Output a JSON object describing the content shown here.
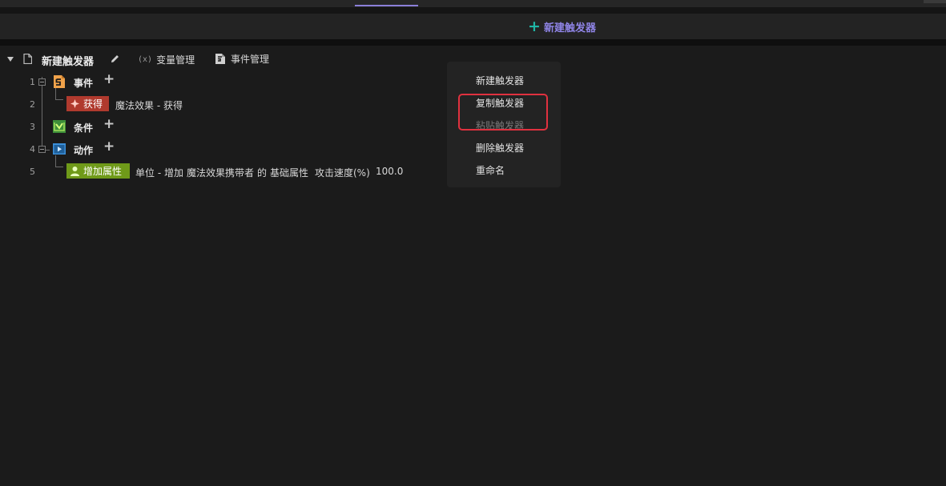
{
  "toolbar": {
    "new_trigger_label": "新建触发器"
  },
  "header": {
    "trigger_name": "新建触发器",
    "variable_manager_icon": "(x)",
    "variable_manager_label": "变量管理",
    "event_manager_label": "事件管理"
  },
  "tree": {
    "rows": [
      {
        "line": "1",
        "section": "事件",
        "icon": "event-icon"
      },
      {
        "line": "2",
        "tag": "获得",
        "text": "魔法效果 - 获得",
        "icon": "sparkle-icon"
      },
      {
        "line": "3",
        "section": "条件",
        "icon": "condition-icon"
      },
      {
        "line": "4",
        "section": "动作",
        "icon": "action-icon"
      },
      {
        "line": "5",
        "tag": "增加属性",
        "icon": "person-icon",
        "parts": {
          "p1": "单位 - 增加",
          "p2": "魔法效果携带者",
          "p3": "的",
          "p4": "基础属性",
          "p5": "攻击速度(%)",
          "p6": "100.0"
        }
      }
    ]
  },
  "context_menu": {
    "items": [
      {
        "label": "新建触发器",
        "enabled": true
      },
      {
        "label": "复制触发器",
        "enabled": true
      },
      {
        "label": "粘贴触发器",
        "enabled": false
      },
      {
        "label": "删除触发器",
        "enabled": true
      },
      {
        "label": "重命名",
        "enabled": true
      }
    ],
    "highlight_color": "#e0313f"
  },
  "colors": {
    "accent_purple": "#8f84e6",
    "accent_teal": "#1fb6a6",
    "event_tag": "#b03a2e",
    "action_tag": "#6f9a19"
  }
}
